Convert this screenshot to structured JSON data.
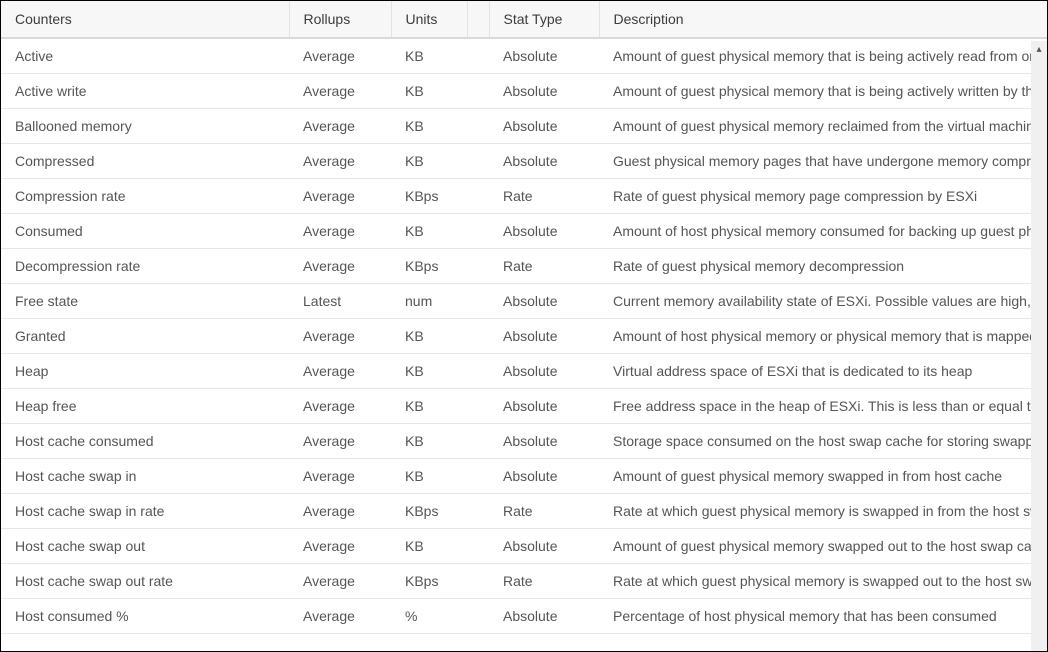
{
  "columns": {
    "counters": "Counters",
    "rollups": "Rollups",
    "units": "Units",
    "stattype": "Stat Type",
    "description": "Description"
  },
  "rows": [
    {
      "counter": "Active",
      "rollup": "Average",
      "unit": "KB",
      "stattype": "Absolute",
      "desc": "Amount of guest physical memory that is being actively read from or written to by the guest"
    },
    {
      "counter": "Active write",
      "rollup": "Average",
      "unit": "KB",
      "stattype": "Absolute",
      "desc": "Amount of guest physical memory that is being actively written by the guest"
    },
    {
      "counter": "Ballooned memory",
      "rollup": "Average",
      "unit": "KB",
      "stattype": "Absolute",
      "desc": "Amount of guest physical memory reclaimed from the virtual machine by the balloon driver"
    },
    {
      "counter": "Compressed",
      "rollup": "Average",
      "unit": "KB",
      "stattype": "Absolute",
      "desc": "Guest physical memory pages that have undergone memory compression"
    },
    {
      "counter": "Compression rate",
      "rollup": "Average",
      "unit": "KBps",
      "stattype": "Rate",
      "desc": "Rate of guest physical memory page compression by ESXi"
    },
    {
      "counter": "Consumed",
      "rollup": "Average",
      "unit": "KB",
      "stattype": "Absolute",
      "desc": "Amount of host physical memory consumed for backing up guest physical memory"
    },
    {
      "counter": "Decompression rate",
      "rollup": "Average",
      "unit": "KBps",
      "stattype": "Rate",
      "desc": "Rate of guest physical memory decompression"
    },
    {
      "counter": "Free state",
      "rollup": "Latest",
      "unit": "num",
      "stattype": "Absolute",
      "desc": "Current memory availability state of ESXi. Possible values are high, clear, soft, hard, low"
    },
    {
      "counter": "Granted",
      "rollup": "Average",
      "unit": "KB",
      "stattype": "Absolute",
      "desc": "Amount of host physical memory or physical memory that is mapped to the virtual machine"
    },
    {
      "counter": "Heap",
      "rollup": "Average",
      "unit": "KB",
      "stattype": "Absolute",
      "desc": "Virtual address space of ESXi that is dedicated to its heap"
    },
    {
      "counter": "Heap free",
      "rollup": "Average",
      "unit": "KB",
      "stattype": "Absolute",
      "desc": "Free address space in the heap of ESXi. This is less than or equal to Heap"
    },
    {
      "counter": "Host cache consumed",
      "rollup": "Average",
      "unit": "KB",
      "stattype": "Absolute",
      "desc": "Storage space consumed on the host swap cache for storing swapped guest physical memory pages"
    },
    {
      "counter": "Host cache swap in",
      "rollup": "Average",
      "unit": "KB",
      "stattype": "Absolute",
      "desc": "Amount of guest physical memory swapped in from host cache"
    },
    {
      "counter": "Host cache swap in rate",
      "rollup": "Average",
      "unit": "KBps",
      "stattype": "Rate",
      "desc": "Rate at which guest physical memory is swapped in from the host swap cache"
    },
    {
      "counter": "Host cache swap out",
      "rollup": "Average",
      "unit": "KB",
      "stattype": "Absolute",
      "desc": "Amount of guest physical memory swapped out to the host swap cache"
    },
    {
      "counter": "Host cache swap out rate",
      "rollup": "Average",
      "unit": "KBps",
      "stattype": "Rate",
      "desc": "Rate at which guest physical memory is swapped out to the host swap cache"
    },
    {
      "counter": "Host consumed %",
      "rollup": "Average",
      "unit": "%",
      "stattype": "Absolute",
      "desc": "Percentage of host physical memory that has been consumed"
    }
  ]
}
